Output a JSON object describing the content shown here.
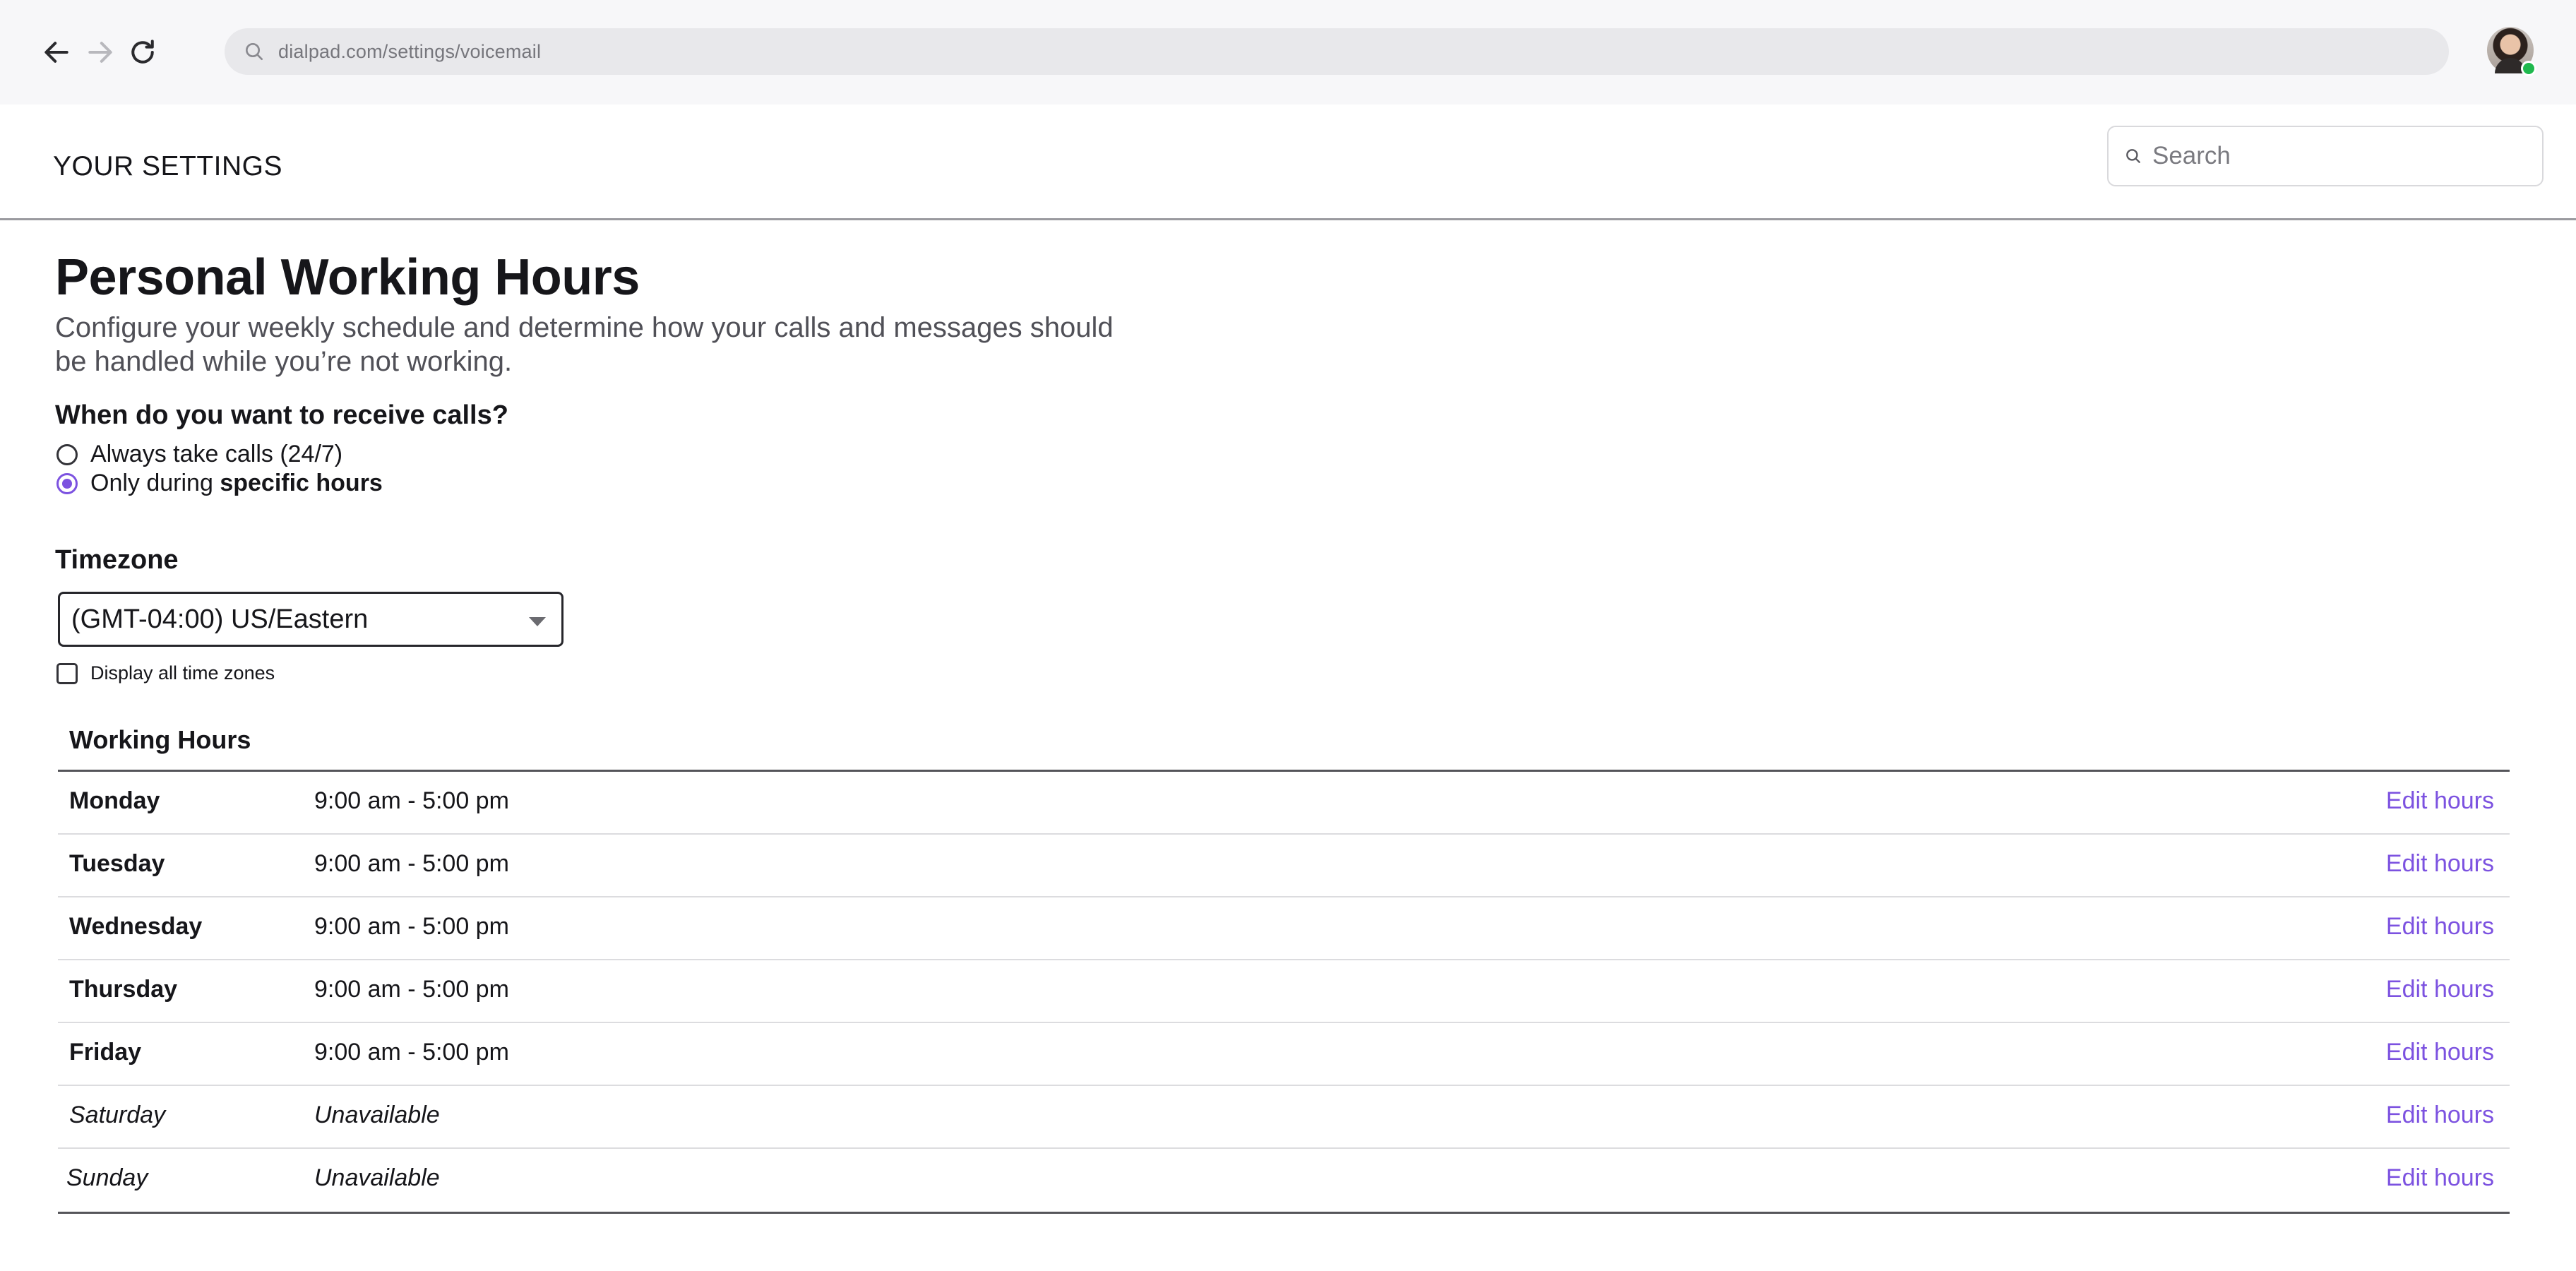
{
  "browser": {
    "url": "dialpad.com/settings/voicemail",
    "back_icon": "arrow-left-icon",
    "forward_icon": "arrow-right-icon",
    "reload_icon": "reload-icon",
    "presence_color": "#1fb84e"
  },
  "header": {
    "title": "YOUR SETTINGS",
    "search_placeholder": "Search"
  },
  "page": {
    "title": "Personal Working Hours",
    "description": "Configure your weekly schedule and determine how your calls and messages should be handled while you’re not working."
  },
  "call_preference": {
    "question": "When do you want to receive calls?",
    "options": [
      {
        "label": "Always take calls (24/7)",
        "checked": false
      },
      {
        "label_prefix": "Only during ",
        "label_emphasis": "specific hours",
        "checked": true
      }
    ]
  },
  "timezone": {
    "label": "Timezone",
    "selected": "(GMT-04:00) US/Eastern",
    "display_all_label": "Display all time zones",
    "display_all_checked": false
  },
  "working_hours": {
    "title": "Working Hours",
    "edit_label": "Edit hours",
    "rows": [
      {
        "day": "Monday",
        "hours": "9:00 am - 5:00 pm"
      },
      {
        "day": "Tuesday",
        "hours": "9:00 am - 5:00 pm"
      },
      {
        "day": "Wednesday",
        "hours": "9:00 am - 5:00 pm"
      },
      {
        "day": "Thursday",
        "hours": "9:00 am - 5:00 pm"
      },
      {
        "day": "Friday",
        "hours": "9:00 am - 5:00 pm"
      },
      {
        "day": "Saturday",
        "hours": "Unavailable"
      },
      {
        "day": "Sunday",
        "hours": "Unavailable"
      }
    ]
  },
  "colors": {
    "accent": "#7c52e0",
    "text": "#16161a",
    "muted": "#505057"
  }
}
